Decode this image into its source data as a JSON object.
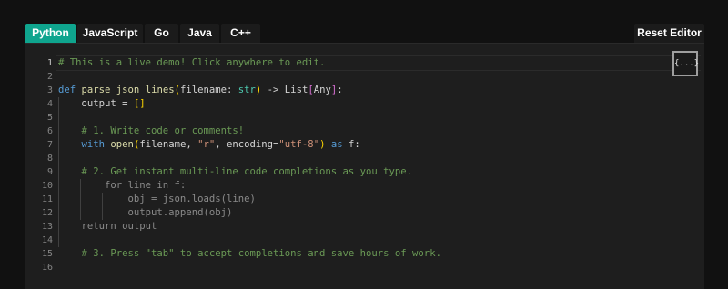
{
  "tabs": [
    {
      "label": "Python",
      "active": true
    },
    {
      "label": "JavaScript",
      "active": false
    },
    {
      "label": "Go",
      "active": false
    },
    {
      "label": "Java",
      "active": false
    },
    {
      "label": "C++",
      "active": false
    }
  ],
  "reset_label": "Reset Editor",
  "format_button_label": "{...}",
  "format_button_icon": "format-code-icon",
  "colors": {
    "accent": "#0fa58e",
    "background": "#111111",
    "editor_background": "#1e1e1e",
    "comment": "#6a9955",
    "keyword": "#569cd6",
    "string": "#ce9178"
  },
  "editor": {
    "current_line": 1,
    "line_numbers": [
      "1",
      "2",
      "3",
      "4",
      "5",
      "6",
      "7",
      "8",
      "9",
      "10",
      "11",
      "12",
      "13",
      "14",
      "15",
      "16"
    ],
    "lines": [
      [
        {
          "t": "# This is a live demo! Click anywhere to edit.",
          "c": "comment"
        }
      ],
      [],
      [
        {
          "t": "def",
          "c": "kw"
        },
        {
          "t": " "
        },
        {
          "t": "parse_json_lines",
          "c": "fn"
        },
        {
          "t": "(",
          "c": "brk"
        },
        {
          "t": "filename: "
        },
        {
          "t": "str",
          "c": "type"
        },
        {
          "t": ")",
          "c": "brk"
        },
        {
          "t": " -> List"
        },
        {
          "t": "[",
          "c": "brk2"
        },
        {
          "t": "Any"
        },
        {
          "t": "]",
          "c": "brk2"
        },
        {
          "t": ":"
        }
      ],
      [
        {
          "t": "    output = "
        },
        {
          "t": "[]",
          "c": "brk"
        }
      ],
      [],
      [
        {
          "t": "    # 1. Write code or comments!",
          "c": "comment"
        }
      ],
      [
        {
          "t": "    "
        },
        {
          "t": "with",
          "c": "kw"
        },
        {
          "t": " "
        },
        {
          "t": "open",
          "c": "fn"
        },
        {
          "t": "(",
          "c": "brk"
        },
        {
          "t": "filename, "
        },
        {
          "t": "\"r\"",
          "c": "str"
        },
        {
          "t": ", encoding="
        },
        {
          "t": "\"utf-8\"",
          "c": "str"
        },
        {
          "t": ")",
          "c": "brk"
        },
        {
          "t": " "
        },
        {
          "t": "as",
          "c": "kw"
        },
        {
          "t": " f:"
        }
      ],
      [],
      [
        {
          "t": "    # 2. Get instant multi-line code completions as you type.",
          "c": "comment"
        }
      ],
      [
        {
          "t": "        for line in f:",
          "c": "ghost"
        }
      ],
      [
        {
          "t": "            obj = json.loads(line)",
          "c": "ghost"
        }
      ],
      [
        {
          "t": "            output.append(obj)",
          "c": "ghost"
        }
      ],
      [
        {
          "t": "    return output",
          "c": "ghost"
        }
      ],
      [],
      [
        {
          "t": "    # 3. Press \"tab\" to accept completions and save hours of work.",
          "c": "comment"
        }
      ],
      []
    ]
  }
}
